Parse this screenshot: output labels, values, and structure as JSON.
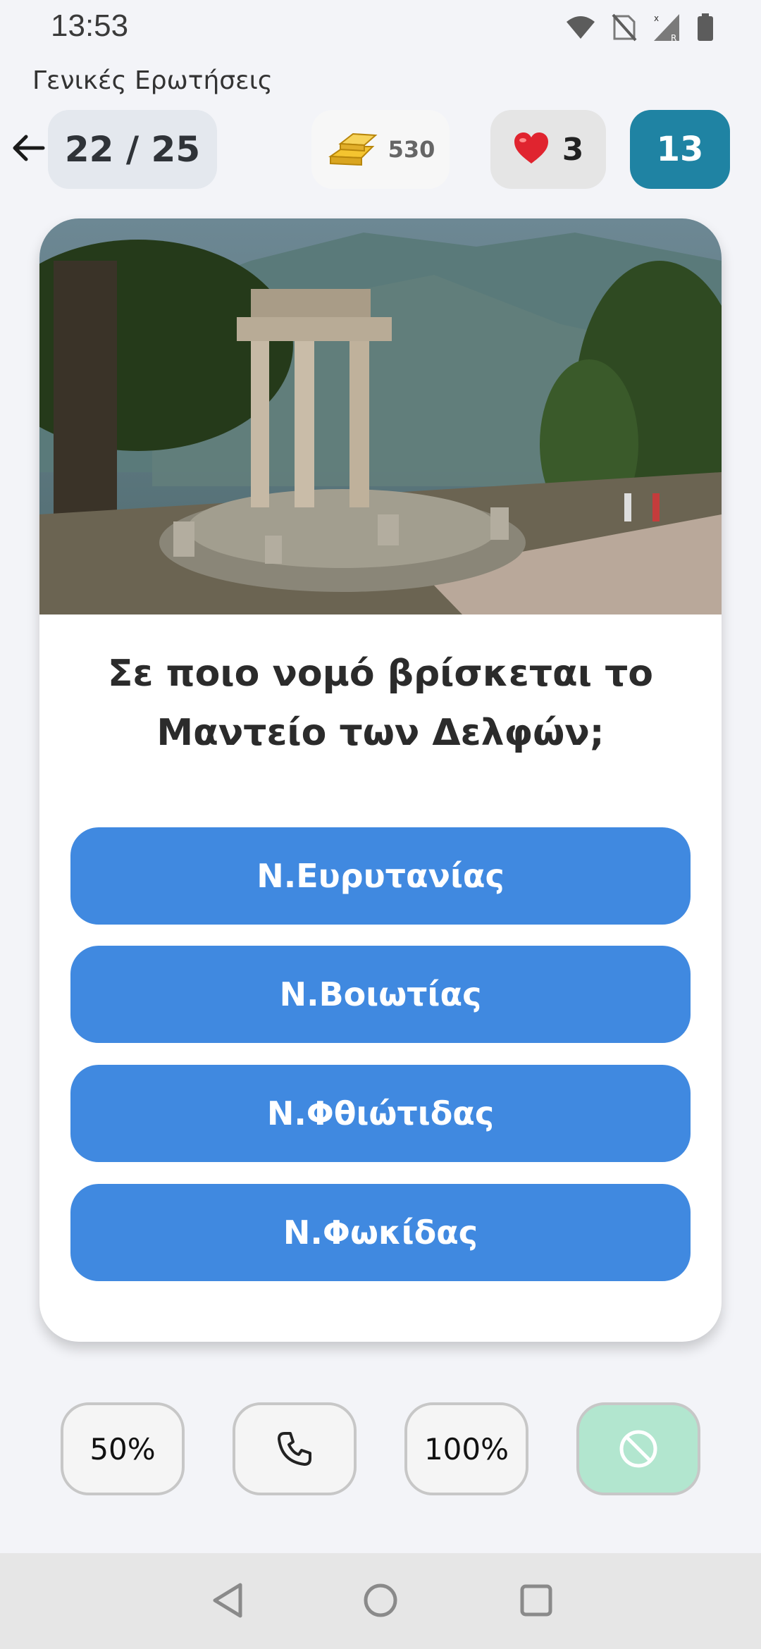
{
  "status": {
    "time": "13:53"
  },
  "category": "Γενικές Ερωτήσεις",
  "header": {
    "progress": "22 / 25",
    "coins": "530",
    "lives": "3",
    "timer": "13"
  },
  "question": {
    "image_alt": "Θόλος του Μαντείου των Δελφών",
    "text": "Σε ποιο νομό βρίσκεται το Μαντείο των Δελφών;"
  },
  "answers": [
    {
      "label": "Ν.Ευρυτανίας"
    },
    {
      "label": "Ν.Βοιωτίας"
    },
    {
      "label": "Ν.Φθιώτιδας"
    },
    {
      "label": "Ν.Φωκίδας"
    }
  ],
  "lifelines": {
    "fifty": "50%",
    "phone_icon": "phone-icon",
    "hundred": "100%",
    "skip_icon": "block-icon"
  },
  "colors": {
    "answer_bg": "#4089e0",
    "timer_bg": "#1f83a3",
    "skip_bg": "#b2e6cf",
    "background": "#f3f4f8"
  },
  "icons": {
    "back": "arrow-left-icon",
    "coins": "gold-bars-icon",
    "lives": "heart-icon",
    "nav_back": "triangle-back-icon",
    "nav_home": "circle-home-icon",
    "nav_recents": "square-recents-icon"
  }
}
